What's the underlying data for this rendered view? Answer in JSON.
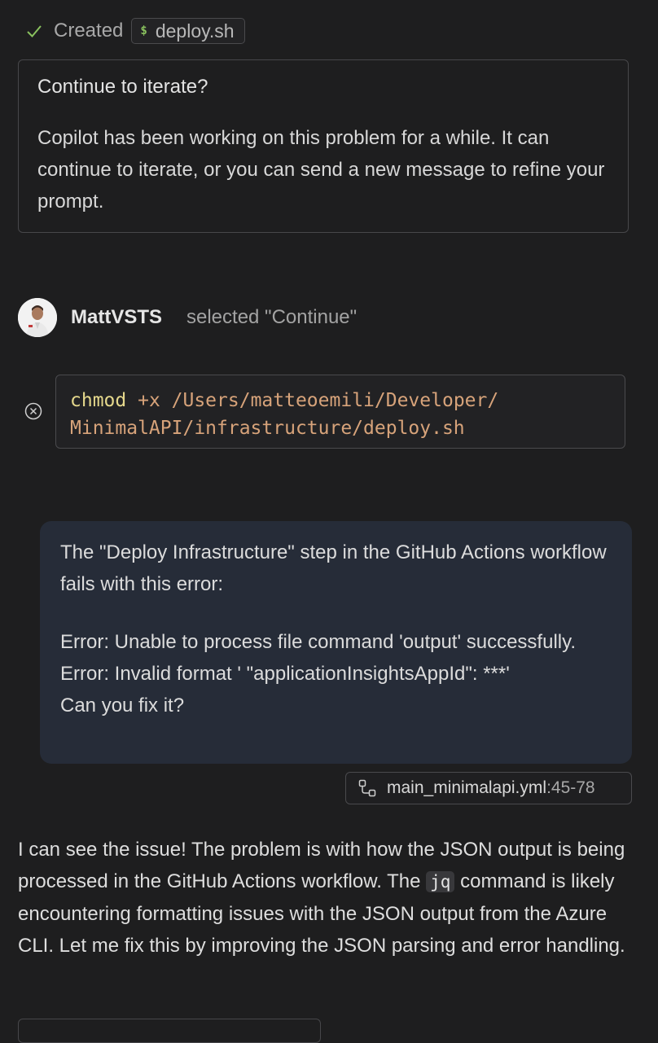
{
  "created": {
    "label": "Created",
    "file_icon": "dollar-sign-icon",
    "file_name": "deploy.sh"
  },
  "continue_prompt": {
    "title": "Continue to iterate?",
    "body": "Copilot has been working on this problem for a while. It can continue to iterate, or you can send a new message to refine your prompt."
  },
  "user_action": {
    "username": "MattVSTS",
    "action": "selected \"Continue\""
  },
  "terminal": {
    "status_icon": "cancel-circle-icon",
    "command_name": "chmod",
    "line1_rest": " +x /Users/matteoemili/Developer/",
    "line2": "MinimalAPI/infrastructure/deploy.sh"
  },
  "user_message": {
    "para1": "The \"Deploy Infrastructure\" step in the GitHub Actions workflow fails with this error:",
    "para2": "Error: Unable to process file command 'output' successfully.\nError: Invalid format ' \"applicationInsightsAppId\": ***'\nCan you fix it?"
  },
  "reference": {
    "icon": "workflow-icon",
    "file_name": "main_minimalapi.yml",
    "range": ":45-78"
  },
  "response": {
    "text_before": "I can see the issue! The problem is with how the JSON output is being processed in the GitHub Actions workflow. The ",
    "code": "jq",
    "text_after": " command is likely encountering formatting issues with the JSON output from the Azure CLI. Let me fix this by improving the JSON parsing and error handling."
  },
  "colors": {
    "background": "#1e1e1f",
    "bubble": "#262c38",
    "check": "#89c15e"
  }
}
